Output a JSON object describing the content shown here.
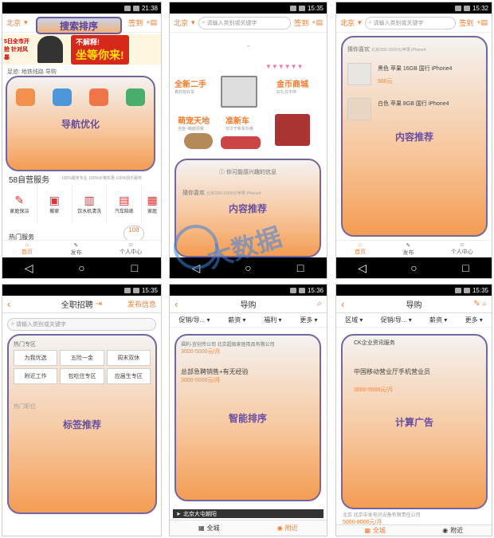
{
  "p1": {
    "time": "21:38",
    "city": "北京",
    "search_title": "搜索排序",
    "signin": "签到",
    "banner_left": "5日全市开抢 针对风暴",
    "banner_right_1": "不解释!",
    "banner_right_2": "坐等你来!",
    "recent": "足迹:   地铁线路   导购",
    "overlay": "导航优化",
    "services_title": "58自营服务",
    "services_sub": "100%服务专业  100%价格实惠  100%快乐服务",
    "services": [
      "家庭保洁",
      "搬家",
      "饮水机清洗",
      "汽车陪练",
      "家庭"
    ],
    "hot": "热门服务",
    "hot_badge": "108",
    "tabs": [
      "首页",
      "发布",
      "个人中心"
    ]
  },
  "p2": {
    "time": "15:35",
    "city": "北京",
    "placeholder": "请输入类别或关键字",
    "signin": "签到",
    "cats": [
      {
        "t": "全新二手",
        "s": "真的有好货"
      },
      {
        "t": "金币商城",
        "s": "好礼兑不停"
      },
      {
        "t": "萌宠天地",
        "s": "全能~萌能把家"
      },
      {
        "t": "准新车",
        "s": "仅次于新车价格"
      }
    ],
    "interest": "你可能感兴趣的信息",
    "guess": "猜你喜欢",
    "guess_sub": "北京/300-1500元/苹果 iPhone4",
    "overlay": "内容推荐"
  },
  "p3": {
    "time": "15:32",
    "city": "北京",
    "placeholder": "请输入类别或关键字",
    "signin": "签到",
    "guess": "猜你喜欢",
    "guess_sub": "北京/300-1500元/苹果 iPhone4",
    "item1": "黑色 苹果 16GB 国行 iPhone4",
    "price1": "900元",
    "item2": "白色 苹果 8GB 国行 iPhone4",
    "overlay": "内容推荐",
    "tabs": [
      "首页",
      "发布",
      "个人中心"
    ]
  },
  "p4": {
    "time": "15:35",
    "title": "全职招聘",
    "right": "发布信息",
    "placeholder": "请输入类别或关键字",
    "hot_area": "热门专区",
    "tags": [
      "为我优选",
      "五险一金",
      "周末双休",
      "附近工作",
      "包吃住专区",
      "应届生专区"
    ],
    "hot_jobs": "热门职位",
    "overlay": "标签推荐"
  },
  "p5": {
    "time": "15:36",
    "title": "导购",
    "filters": [
      "促销/导...",
      "薪资",
      "福利",
      "更多"
    ],
    "job1": "福利-宜创传公司 北京超级家居用品有限公司",
    "salary1": "3000-5000元/月",
    "job2": "总部急聘销售+有无经验",
    "salary2": "3000-5000元/月",
    "location": "北京大屯朝阳",
    "bottom": [
      "全城",
      "附近"
    ],
    "overlay": "智能排序"
  },
  "p6": {
    "time": "15:35",
    "title": "导购",
    "filters": [
      "区域",
      "促销/导...",
      "薪资",
      "更多"
    ],
    "job0": "CK企业资讯服务",
    "job1": "中国移动营业厅手机营业员",
    "salary1": "3000-5000元/月",
    "job_bottom": "北京  北京中发电讯设备有限责任公司",
    "salary_bottom": "5000-8000元/月",
    "bottom": [
      "全城",
      "附近"
    ],
    "overlay": "计算广告"
  },
  "watermark": "大数据"
}
